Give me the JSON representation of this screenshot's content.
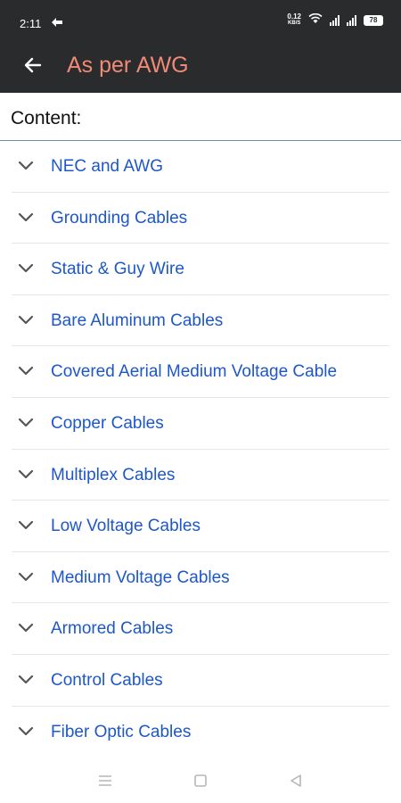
{
  "status_bar": {
    "time": "2:11",
    "net_speed_value": "0.12",
    "net_speed_unit": "KB/S",
    "battery": "78"
  },
  "app_bar": {
    "title": "As per AWG",
    "back_icon": "arrow-left-icon",
    "background_color": "#2a2b2c",
    "title_color": "#f08a76"
  },
  "content": {
    "label": "Content:",
    "items": [
      {
        "label": "NEC and AWG"
      },
      {
        "label": "Grounding Cables"
      },
      {
        "label": "Static & Guy Wire"
      },
      {
        "label": "Bare Aluminum Cables"
      },
      {
        "label": "Covered Aerial Medium Voltage Cable"
      },
      {
        "label": "Copper Cables"
      },
      {
        "label": "Multiplex Cables"
      },
      {
        "label": "Low Voltage Cables"
      },
      {
        "label": "Medium Voltage Cables"
      },
      {
        "label": "Armored Cables"
      },
      {
        "label": "Control Cables"
      },
      {
        "label": "Fiber Optic Cables"
      }
    ],
    "link_color": "#1d57c8",
    "expand_icon": "chevron-down-icon"
  },
  "nav_bar": {
    "icons": [
      "menu-icon",
      "home-square-icon",
      "back-triangle-icon"
    ]
  }
}
